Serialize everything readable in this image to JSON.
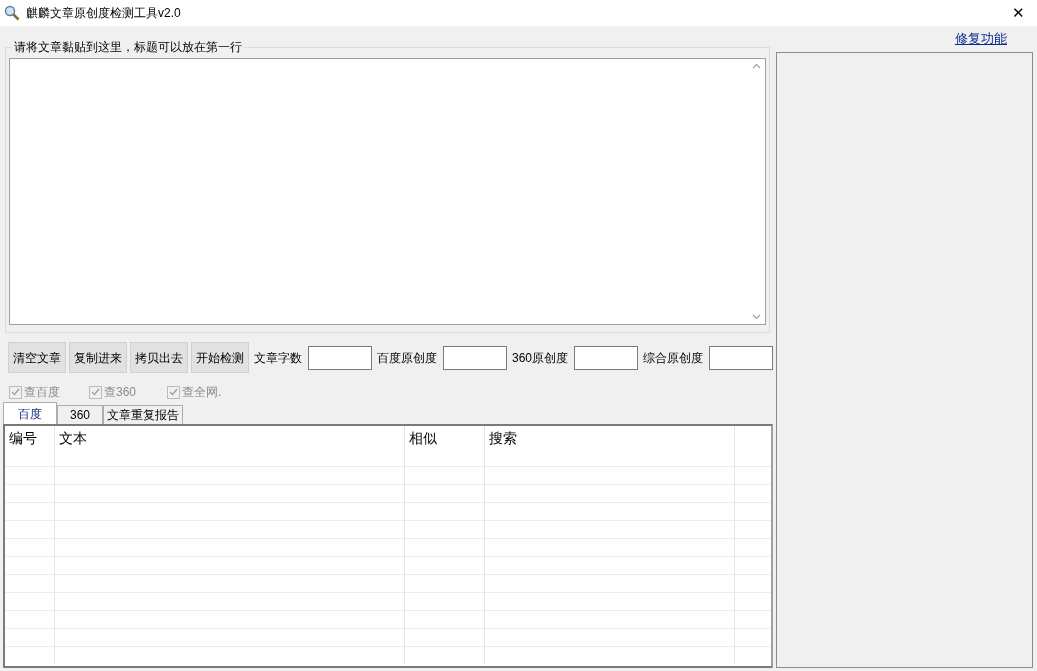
{
  "window": {
    "title": "麒麟文章原创度检测工具v2.0",
    "close": "✕"
  },
  "repair_link": "修复功能",
  "article_group": {
    "legend": "请将文章黏贴到这里，标题可以放在第一行"
  },
  "buttons": [
    "清空文章",
    "复制进来",
    "拷贝出去",
    "开始检测"
  ],
  "stats": [
    {
      "label": "文章字数"
    },
    {
      "label": "百度原创度"
    },
    {
      "label": "360原创度"
    },
    {
      "label": "综合原创度"
    }
  ],
  "checkboxes": [
    {
      "label": "查百度",
      "checked": true,
      "disabled": true
    },
    {
      "label": "查360",
      "checked": true,
      "disabled": true
    },
    {
      "label": "查全网.",
      "checked": true,
      "disabled": true
    }
  ],
  "tabs": [
    {
      "label": "百度",
      "selected": true
    },
    {
      "label": "360",
      "selected": false
    },
    {
      "label": "文章重复报告",
      "selected": false
    }
  ],
  "table": {
    "columns": [
      "编号",
      "文本",
      "相似",
      "搜索"
    ]
  }
}
